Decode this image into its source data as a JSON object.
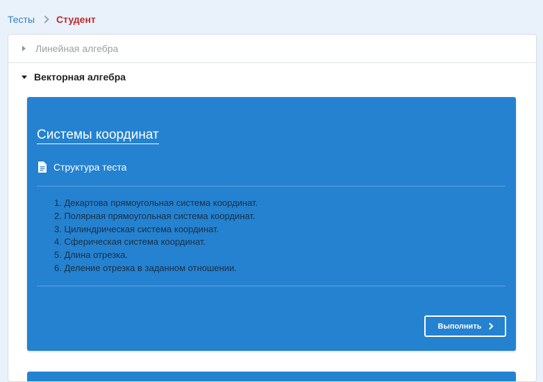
{
  "breadcrumb": {
    "parent": "Тесты",
    "current": "Студент"
  },
  "sections": [
    {
      "title": "Линейная алгебра",
      "expanded": false
    },
    {
      "title": "Векторная алгебра",
      "expanded": true
    }
  ],
  "test_card": {
    "title": "Системы координат",
    "structure_label": "Структура теста",
    "structure_icon": "document-icon",
    "topics": [
      "1. Декартова прямоугольная система координат.",
      "2. Полярная прямоугольная система координат.",
      "3. Цилиндрическая система координат.",
      "4. Сферическая система координат.",
      "5. Длина отрезка.",
      "6. Деление отрезка в заданном отношении."
    ],
    "run_button": "Выполнить",
    "run_icon": "chevron-right-icon",
    "color": "#2482d0"
  },
  "colors": {
    "link": "#2f7fc4",
    "current_crumb": "#c1272d",
    "background": "#e9f2fa"
  }
}
